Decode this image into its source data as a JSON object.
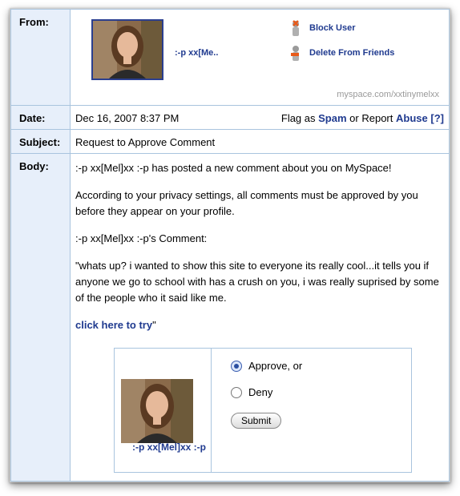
{
  "labels": {
    "from": "From:",
    "date": "Date:",
    "subject": "Subject:",
    "body": "Body:"
  },
  "from": {
    "name": ":-p xx[Me..",
    "actions": {
      "block": "Block User",
      "delete": "Delete From Friends"
    },
    "profile_url": "myspace.com/xxtinymelxx"
  },
  "date": {
    "value": "Dec 16, 2007 8:37 PM",
    "flag_prefix": "Flag as",
    "spam": "Spam",
    "or_report": "or Report",
    "abuse": "Abuse",
    "bracket_open": "[",
    "help": "?",
    "bracket_close": "]"
  },
  "subject": "Request to Approve Comment",
  "body": {
    "line1": ":-p xx[Mel]xx :-p has posted a new comment about you on MySpace!",
    "line2": "According to your privacy settings, all comments must be approved by you before they appear on your profile.",
    "line3": ":-p xx[Mel]xx :-p's Comment:",
    "quote": "\"whats up? i wanted to show this site to everyone its really cool...it tells you if anyone we go to school with has a crush on you, i was really suprised by some of the people who it said like me.",
    "link": "click here to try",
    "link_suffix": "\""
  },
  "approve": {
    "commenter": ":-p xx[Mel]xx :-p",
    "approve_label": "Approve, or",
    "deny_label": "Deny",
    "submit": "Submit",
    "selected": "approve"
  },
  "colors": {
    "link": "#1f3a8f",
    "label_bg": "#e7effa",
    "border": "#a9c4de"
  }
}
